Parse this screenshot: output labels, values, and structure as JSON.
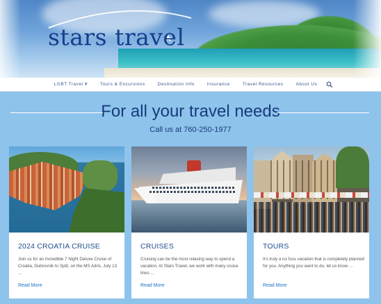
{
  "brand": {
    "name": "stars travel"
  },
  "nav": {
    "items": [
      {
        "label": "LGBT Travel ¥"
      },
      {
        "label": "Tours & Excursions"
      },
      {
        "label": "Destination Info"
      },
      {
        "label": "Insurance"
      },
      {
        "label": "Travel Resources"
      },
      {
        "label": "About Us"
      }
    ],
    "search_icon": "search-icon"
  },
  "hero": {
    "title": "For all your travel needs",
    "phone": "Call us at 760-250-1977"
  },
  "cards": [
    {
      "title": "2024 CROATIA CRUISE",
      "excerpt": "Join us for an incredible 7 Night Deluxe Cruise of Croatia, Dubrovnik to Split, on the MS Adris, July 13 ...",
      "link": "Read More"
    },
    {
      "title": "CRUISES",
      "excerpt": "Cruising can be the most relaxing way to spend a vacation. At Stars Travel, we work with many cruise lines ...",
      "link": "Read More"
    },
    {
      "title": "TOURS",
      "excerpt": "It's truly a no fuss vacation that is completely planned for you. Anything you want to do, let us know ...",
      "link": "Read More"
    }
  ],
  "colors": {
    "page_bg": "#8ec3ec",
    "heading": "#173b7a",
    "link": "#1a73c7"
  }
}
